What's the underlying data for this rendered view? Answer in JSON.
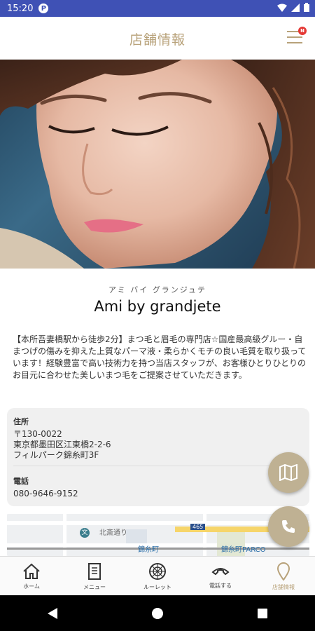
{
  "status_bar": {
    "time": "15:20",
    "app_icon_letter": "P"
  },
  "header": {
    "title": "店舗情報",
    "badge": "N"
  },
  "shop": {
    "kana": "アミ バイ グランジュテ",
    "name": "Ami by grandjete",
    "description": "【本所吾妻橋駅から徒歩2分】まつ毛と眉毛の専門店☆国産最高級グルー・自まつげの傷みを抑えた上質なパーマ液・柔らかくモチの良い毛質を取り扱っています！経験豊富で高い技術力を持つ当店スタッフが、お客様ひとりひとりのお目元に合わせた美しいまつ毛をご提案させていただきます。"
  },
  "info": {
    "address_label": "住所",
    "address_lines": [
      "〒130-0022",
      "東京都墨田区江東橋2-2-6",
      "フィルパーク錦糸町3F"
    ],
    "phone_label": "電話",
    "phone": "080-9646-9152"
  },
  "map": {
    "street": "北斎通り",
    "station": "錦糸町",
    "parco": "錦糸町PARCO",
    "route": "465",
    "bunkyo_mark": "文"
  },
  "bottom_nav": [
    {
      "label": "ホーム",
      "icon": "home-icon"
    },
    {
      "label": "メニュー",
      "icon": "menu-book-icon"
    },
    {
      "label": "ルーレット",
      "icon": "roulette-icon"
    },
    {
      "label": "電話する",
      "icon": "phone-icon"
    },
    {
      "label": "店舗情報",
      "icon": "location-pin-icon"
    }
  ],
  "colors": {
    "accent": "#b8a27a",
    "fab": "#bfb193",
    "status_bar": "#3f51b5"
  }
}
